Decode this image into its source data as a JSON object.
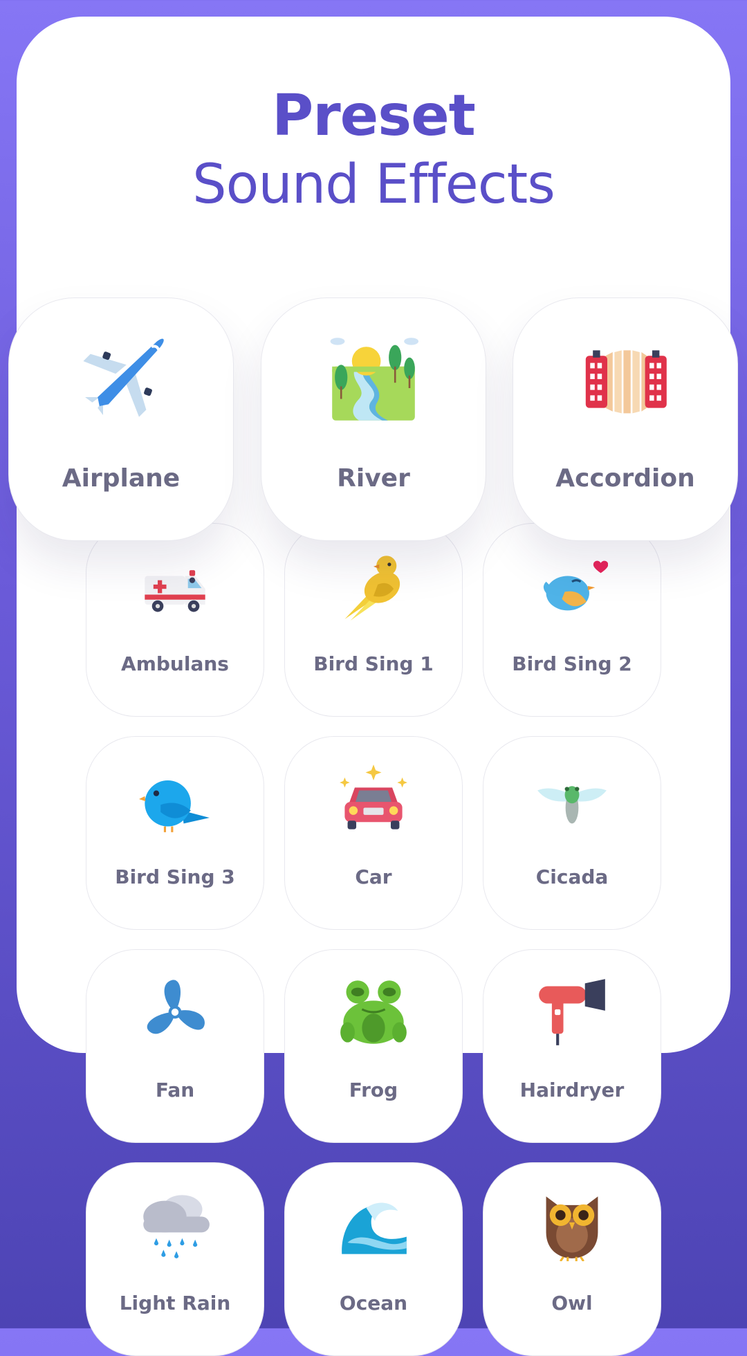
{
  "header": {
    "title_bold": "Preset",
    "title_light": "Sound Effects"
  },
  "colors": {
    "accent": "#5a4fc8",
    "label": "#6b6a85",
    "bg_top": "#8676f5",
    "bg_bottom": "#4d44b4"
  },
  "featured": [
    {
      "label": "Airplane",
      "icon": "airplane-icon"
    },
    {
      "label": "River",
      "icon": "river-landscape-icon"
    },
    {
      "label": "Accordion",
      "icon": "accordion-icon"
    }
  ],
  "sounds": [
    {
      "label": "Ambulans",
      "icon": "ambulance-icon"
    },
    {
      "label": "Bird Sing 1",
      "icon": "yellow-bird-icon"
    },
    {
      "label": "Bird Sing 2",
      "icon": "bird-heart-icon"
    },
    {
      "label": "Bird Sing 3",
      "icon": "blue-bird-icon"
    },
    {
      "label": "Car",
      "icon": "car-icon"
    },
    {
      "label": "Cicada",
      "icon": "cicada-icon"
    },
    {
      "label": "Fan",
      "icon": "fan-icon"
    },
    {
      "label": "Frog",
      "icon": "frog-icon"
    },
    {
      "label": "Hairdryer",
      "icon": "hairdryer-icon"
    },
    {
      "label": "Light Rain",
      "icon": "rain-cloud-icon"
    },
    {
      "label": "Ocean",
      "icon": "ocean-wave-icon"
    },
    {
      "label": "Owl",
      "icon": "owl-icon"
    }
  ]
}
